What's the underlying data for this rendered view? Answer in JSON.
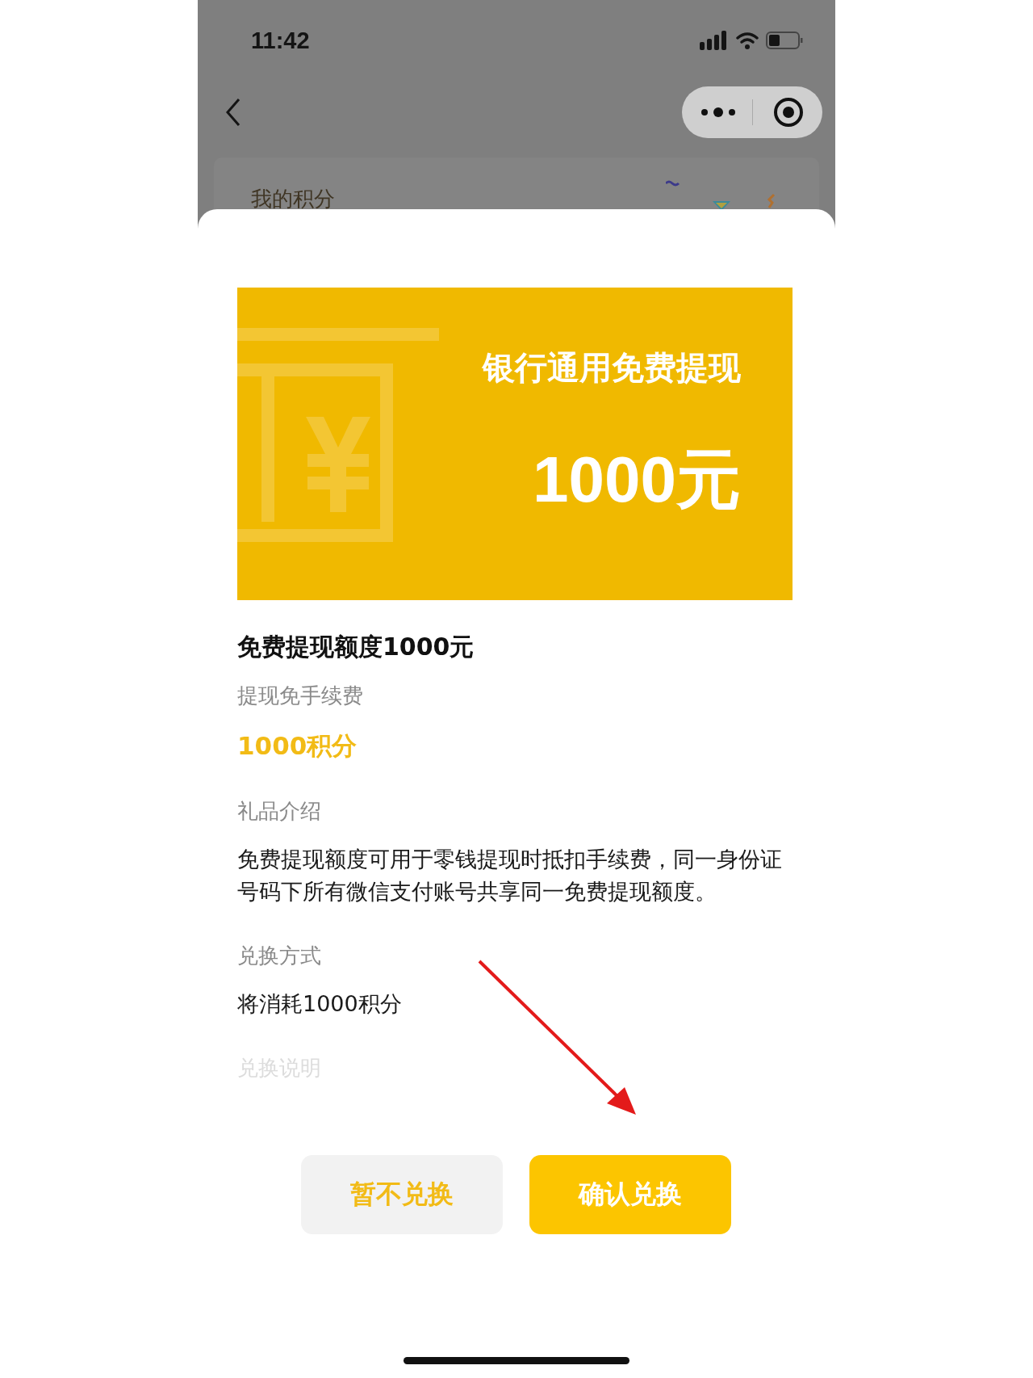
{
  "status_bar": {
    "time": "11:42"
  },
  "background_page": {
    "card_title": "我的积分"
  },
  "banner": {
    "title": "银行通用免费提现",
    "amount": "1000元"
  },
  "gift": {
    "name": "免费提现额度1000元",
    "subtitle": "提现免手续费",
    "price": "1000积分"
  },
  "sections": [
    {
      "heading": "礼品介绍",
      "body": "免费提现额度可用于零钱提现时抵扣手续费，同一身份证号码下所有微信支付账号共享同一免费提现额度。",
      "faded": false
    },
    {
      "heading": "兑换方式",
      "body": "将消耗1000积分",
      "faded": false
    },
    {
      "heading": "兑换说明",
      "faded": true
    }
  ],
  "buttons": [
    {
      "label": "暂不兑换",
      "kind": "secondary"
    },
    {
      "label": "确认兑换",
      "kind": "primary"
    }
  ]
}
